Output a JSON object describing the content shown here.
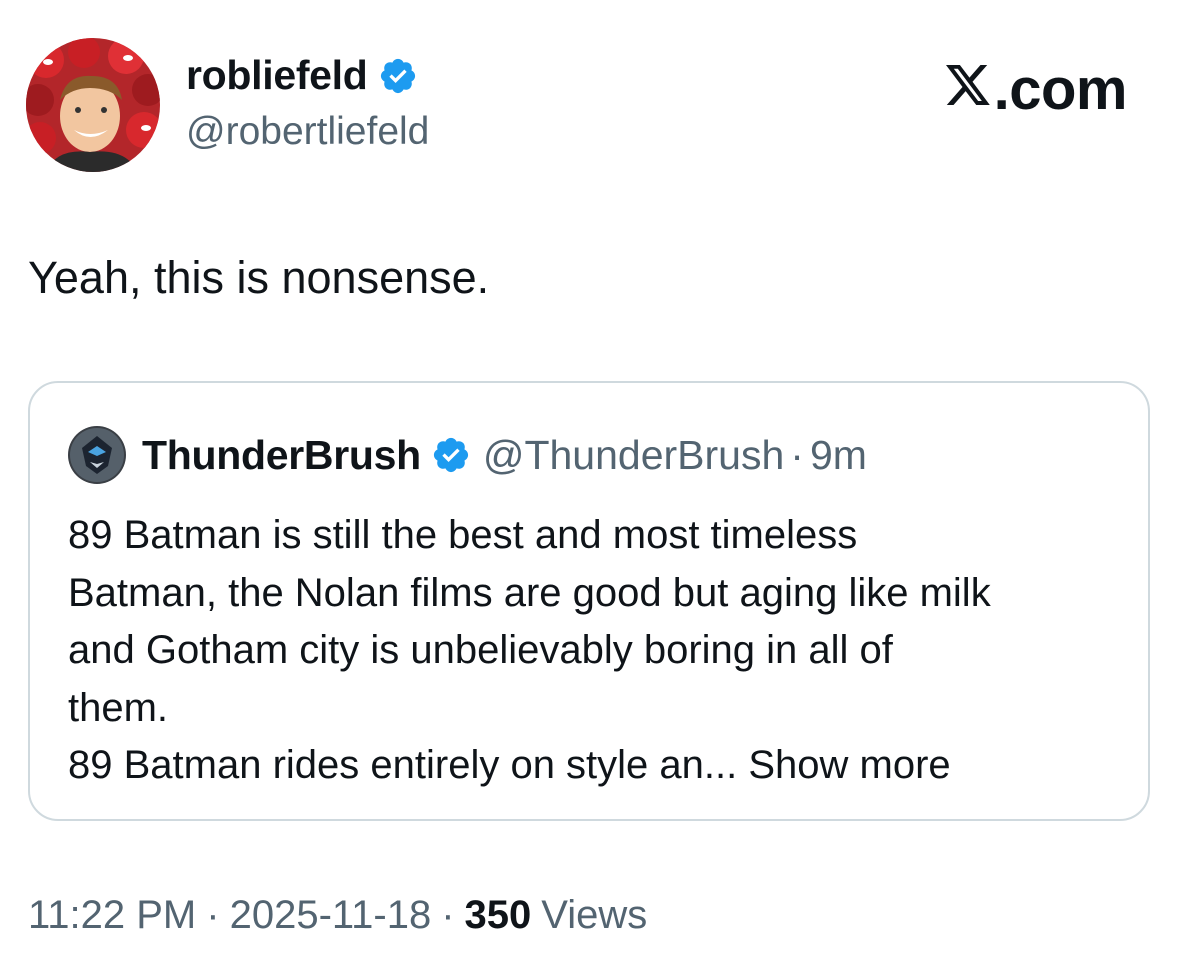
{
  "author": {
    "display_name": "robliefeld",
    "handle": "@robertliefeld",
    "verified": true,
    "avatar_icon": "avatar-photo"
  },
  "brand": {
    "logo_icon": "x-logo-icon",
    "suffix": ".com"
  },
  "tweet": {
    "text": "Yeah, this is nonsense."
  },
  "quoted": {
    "display_name": "ThunderBrush",
    "handle": "@ThunderBrush",
    "separator": "·",
    "time": "9m",
    "verified": true,
    "lines": [
      "89 Batman is still the best and most timeless",
      "Batman, the Nolan films are good but aging like milk",
      "and Gotham city is unbelievably boring in all of",
      "them.",
      "89 Batman rides entirely on style an..."
    ],
    "show_more": "Show more"
  },
  "meta": {
    "time": "11:22 PM",
    "separator": "·",
    "date": "2025-11-18",
    "views_count": "350",
    "views_label": "Views"
  },
  "colors": {
    "verified": "#1d9bf0",
    "secondary_text": "#536471",
    "border": "#cfd9de"
  }
}
